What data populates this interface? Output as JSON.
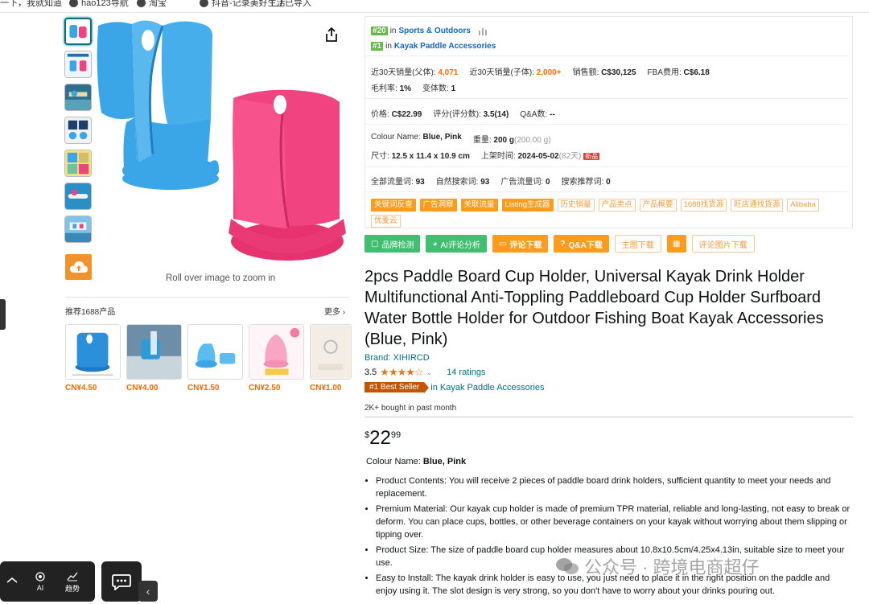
{
  "bookmarks": [
    "一下，我就知道",
    "hao123导航",
    "淘宝",
    "抖音-记录美好生活",
    "已导入"
  ],
  "gallery": {
    "zoom_hint": "Roll over image to zoom in"
  },
  "recommend": {
    "title": "推荐1688产品",
    "more": "更多",
    "items": [
      {
        "price": "CN¥4.50"
      },
      {
        "price": "CN¥4.00"
      },
      {
        "price": "CN¥1.50"
      },
      {
        "price": "CN¥2.50"
      },
      {
        "price": "CN¥1.00"
      }
    ]
  },
  "float_bar": {
    "ai_label": "AI",
    "trend_label": "趋势"
  },
  "panel": {
    "rank1": {
      "badge": "#20",
      "in": "in",
      "category": "Sports & Outdoors"
    },
    "rank2": {
      "badge": "#1",
      "in": "in",
      "category": "Kayak Paddle Accessories"
    },
    "sales_parent_label": "近30天销量(父体):",
    "sales_parent_value": "4,071",
    "sales_child_label": "近30天销量(子体):",
    "sales_child_value": "2,000+",
    "revenue_label": "销售额:",
    "revenue_value": "C$30,125",
    "fba_label": "FBA费用:",
    "fba_value": "C$6.18",
    "margin_label": "毛利率:",
    "margin_value": "1%",
    "variants_label": "变体数:",
    "variants_value": "1",
    "price_label": "价格:",
    "price_value": "C$22.99",
    "score_label": "评分(评分数):",
    "score_value": "3.5(14)",
    "qa_label": "Q&A数:",
    "qa_value": "--",
    "colour_label": "Colour Name:",
    "colour_value": "Blue, Pink",
    "weight_label": "重量:",
    "weight_value": "200 g",
    "weight_extra": "(200.00 g)",
    "size_label": "尺寸:",
    "size_value": "12.5 x 11.4 x 10.9 cm",
    "listed_label": "上架时间:",
    "listed_value": "2024-05-02",
    "listed_extra": "(82天)",
    "new_badge": "新品",
    "traffic_total_label": "全部流量词:",
    "traffic_total_value": "93",
    "traffic_natural_label": "自然搜索词:",
    "traffic_natural_value": "93",
    "traffic_ad_label": "广告流量词:",
    "traffic_ad_value": "0",
    "traffic_rec_label": "搜索推荐词:",
    "traffic_rec_value": "0",
    "tags": [
      {
        "label": "关键词反查",
        "solid": true
      },
      {
        "label": "广告洞察",
        "solid": true
      },
      {
        "label": "关联流量",
        "solid": true
      },
      {
        "label": "Listing生成器",
        "solid": true
      },
      {
        "label": "历史销量",
        "solid": false
      },
      {
        "label": "产品卖点",
        "solid": false
      },
      {
        "label": "产品概要",
        "solid": false
      },
      {
        "label": "1688找货源",
        "solid": false
      },
      {
        "label": "旺店通找货源",
        "solid": false
      },
      {
        "label": "Alibaba",
        "solid": false
      },
      {
        "label": "优麦云",
        "solid": false
      }
    ]
  },
  "buttons": {
    "brand_check": "品牌检测",
    "ai_review": "AI评论分析",
    "review_download": "评论下载",
    "qa_download": "Q&A下载",
    "main_image_download": "主图下载",
    "review_image_download": "评论图片下载"
  },
  "product": {
    "title": "2pcs Paddle Board Cup Holder, Universal Kayak Drink Holder Multifunctional Anti-Toppling Paddleboard Cup Holder Surfboard Water Bottle Holder for Outdoor Fishing Boat Kayak Accessories (Blue, Pink)",
    "brand": "Brand: XIHIRCD",
    "rating": "3.5",
    "stars": "★★★★☆",
    "ratings_count": "14 ratings",
    "best_seller_badge": "#1 Best Seller",
    "best_seller_category": "in Kayak Paddle Accessories",
    "bought": "2K+ bought in past month",
    "price_symbol": "$",
    "price_whole": "22",
    "price_fraction": "99",
    "colour_label": "Colour Name:",
    "colour_value": "Blue, Pink",
    "bullets": [
      "Product Contents: You will receive 2 pieces of paddle board drink holders, sufficient quantity to meet your needs and replacement.",
      "Premium Material: Our kayak cup holder is made of premium TPR material, reliable and long-lasting, not easy to break or deform. You can place cups, bottles, or other beverage containers on your kayak without worrying about them slipping or tipping over.",
      "Product Size: The size of paddle board cup holder measures about 10.8x10.5cm/4.25x4.13in, suitable size to meet your use.",
      "Easy to Install: The kayak drink holder is easy to use, you just need to place it in the right position on the paddle and enjoy using it. The slot design is very strong, so you don't have to worry about your drinks pouring out."
    ]
  },
  "watermark": "公众号 · 跨境电商超仔",
  "colors": {
    "blue_holder": "#3aa6e8",
    "pink_holder": "#f0437f",
    "link": "#007185",
    "accent_orange": "#ff9b1a",
    "green": "#3fbf6f"
  }
}
